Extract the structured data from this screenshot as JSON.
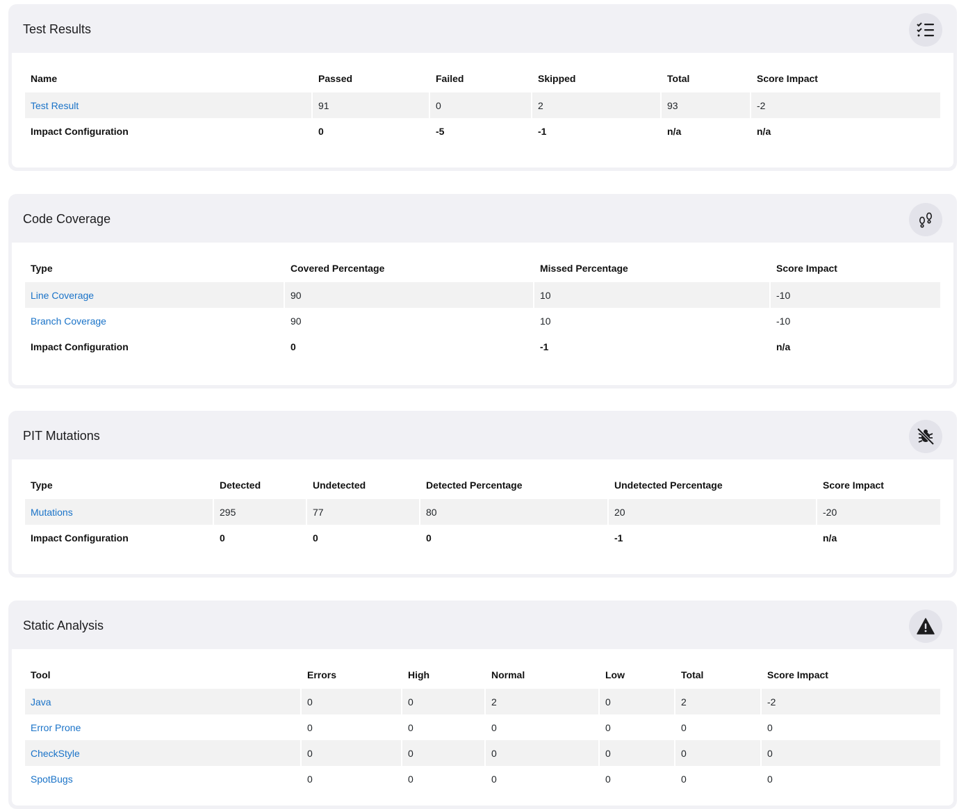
{
  "test_results": {
    "title": "Test Results",
    "icon": "checklist-icon",
    "headers": [
      "Name",
      "Passed",
      "Failed",
      "Skipped",
      "Total",
      "Score Impact"
    ],
    "rows": [
      [
        "Test Result",
        "91",
        "0",
        "2",
        "93",
        "-2"
      ]
    ],
    "impact": [
      "Impact Configuration",
      "0",
      "-5",
      "-1",
      "n/a",
      "n/a"
    ]
  },
  "code_coverage": {
    "title": "Code Coverage",
    "icon": "footprints-icon",
    "headers": [
      "Type",
      "Covered Percentage",
      "Missed Percentage",
      "Score Impact"
    ],
    "rows": [
      [
        "Line Coverage",
        "90",
        "10",
        "-10"
      ],
      [
        "Branch Coverage",
        "90",
        "10",
        "-10"
      ]
    ],
    "impact": [
      "Impact Configuration",
      "0",
      "-1",
      "n/a"
    ]
  },
  "pit_mutations": {
    "title": "PIT Mutations",
    "icon": "bug-off-icon",
    "headers": [
      "Type",
      "Detected",
      "Undetected",
      "Detected Percentage",
      "Undetected Percentage",
      "Score Impact"
    ],
    "rows": [
      [
        "Mutations",
        "295",
        "77",
        "80",
        "20",
        "-20"
      ]
    ],
    "impact": [
      "Impact Configuration",
      "0",
      "0",
      "0",
      "-1",
      "n/a"
    ]
  },
  "static_analysis": {
    "title": "Static Analysis",
    "icon": "warning-triangle-icon",
    "headers": [
      "Tool",
      "Errors",
      "High",
      "Normal",
      "Low",
      "Total",
      "Score Impact"
    ],
    "rows": [
      [
        "Java",
        "0",
        "0",
        "2",
        "0",
        "2",
        "-2"
      ],
      [
        "Error Prone",
        "0",
        "0",
        "0",
        "0",
        "0",
        "0"
      ],
      [
        "CheckStyle",
        "0",
        "0",
        "0",
        "0",
        "0",
        "0"
      ],
      [
        "SpotBugs",
        "0",
        "0",
        "0",
        "0",
        "0",
        "0"
      ]
    ]
  }
}
